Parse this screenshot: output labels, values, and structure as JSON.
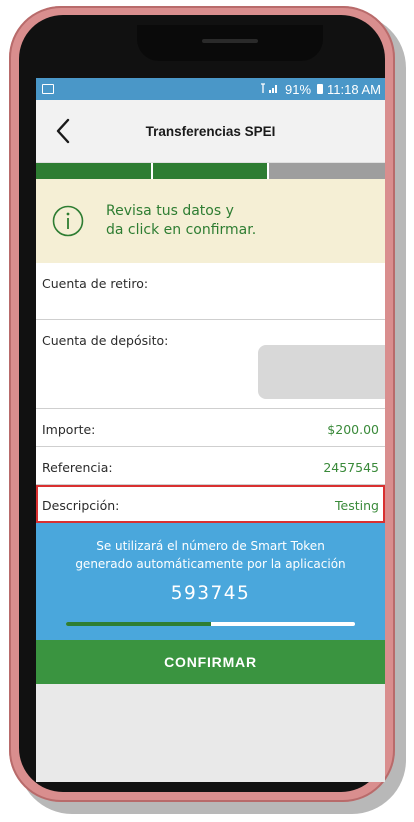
{
  "status_bar": {
    "signal_text": "ǀ .ıl",
    "battery": "91%",
    "time": "11:18 AM"
  },
  "header": {
    "title": "Transferencias SPEI"
  },
  "progress": {
    "completed_steps": 2,
    "total_steps": 3
  },
  "notice": {
    "line1": "Revisa tus datos y",
    "line2": "da click en confirmar."
  },
  "fields": {
    "retiro": {
      "label": "Cuenta de retiro:"
    },
    "deposito": {
      "label": "Cuenta de depósito:"
    },
    "importe": {
      "label": "Importe:",
      "value": "$200.00"
    },
    "referencia": {
      "label": "Referencia:",
      "value": "2457545"
    },
    "descripcion": {
      "label": "Descripción:",
      "value": "Testing"
    }
  },
  "token": {
    "line1": "Se utilizará el número de Smart Token",
    "line2": "generado automáticamente por la aplicación",
    "code": "593745",
    "progress": 0.5
  },
  "actions": {
    "confirm_label": "CONFIRMAR"
  },
  "colors": {
    "brand_green": "#2e7d32",
    "status_blue": "#4a97c8",
    "token_blue": "#4aa7dc",
    "highlight_red": "#d93030"
  }
}
